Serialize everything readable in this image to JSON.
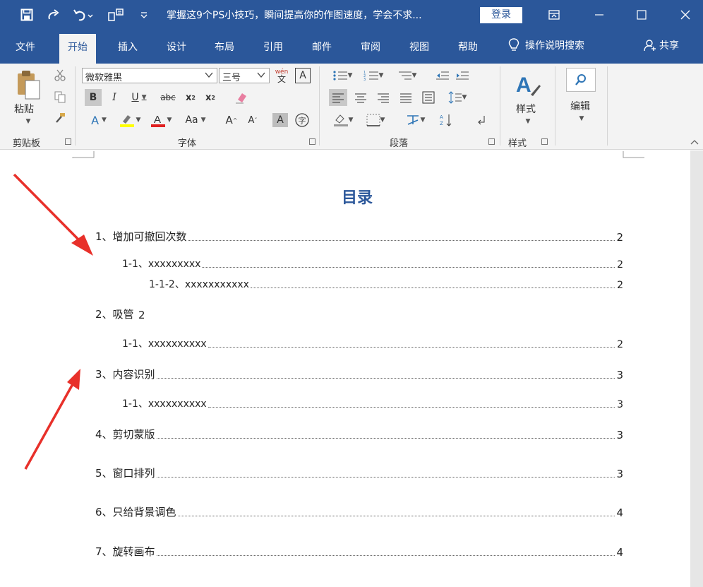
{
  "title_bar": {
    "document_title": "掌握这9个PS小技巧，瞬间提高你的作图速度，学会不求...",
    "login_label": "登录",
    "icons": [
      "save-icon",
      "redo-icon",
      "undo-icon",
      "format-icon",
      "customize-qat-icon",
      "ribbon-display-icon",
      "minimize-icon",
      "maximize-icon",
      "close-icon"
    ]
  },
  "tabs": [
    "文件",
    "开始",
    "插入",
    "设计",
    "布局",
    "引用",
    "邮件",
    "审阅",
    "视图",
    "帮助"
  ],
  "active_tab": "开始",
  "tell_me": "操作说明搜索",
  "share": "共享",
  "ribbon": {
    "clipboard": {
      "paste_label": "粘贴",
      "group_label": "剪贴板"
    },
    "font": {
      "font_name": "微软雅黑",
      "font_size": "三号",
      "phonetic": "wén",
      "group_label": "字体",
      "change_case": "Aa"
    },
    "paragraph": {
      "group_label": "段落"
    },
    "styles": {
      "button_label": "样式",
      "group_label": "样式"
    },
    "editing": {
      "button_label": "编辑"
    }
  },
  "document": {
    "toc_title": "目录",
    "entries": [
      {
        "text": "1、增加可撤回次数",
        "page": "2",
        "level": 1
      },
      {
        "text": "1-1、xxxxxxxxx",
        "page": "2",
        "level": 2
      },
      {
        "text": "1-1-2、xxxxxxxxxxx",
        "page": "2",
        "level": 3
      },
      {
        "text": "2、吸管",
        "page": "2",
        "level": 1,
        "no_leader": true
      },
      {
        "text": "1-1、xxxxxxxxxx",
        "page": "2",
        "level": 2
      },
      {
        "text": "3、内容识别",
        "page": "3",
        "level": 1
      },
      {
        "text": "1-1、xxxxxxxxxx",
        "page": "3",
        "level": 2
      },
      {
        "text": "4、剪切蒙版",
        "page": "3",
        "level": 1
      },
      {
        "text": "5、窗口排列",
        "page": "3",
        "level": 1
      },
      {
        "text": "6、只给背景调色",
        "page": "4",
        "level": 1
      },
      {
        "text": "7、旋转画布",
        "page": "4",
        "level": 1
      }
    ]
  },
  "colors": {
    "word_blue": "#2b579a",
    "ribbon_bg": "#f3f3f3",
    "arrow_red": "#e8302a"
  }
}
